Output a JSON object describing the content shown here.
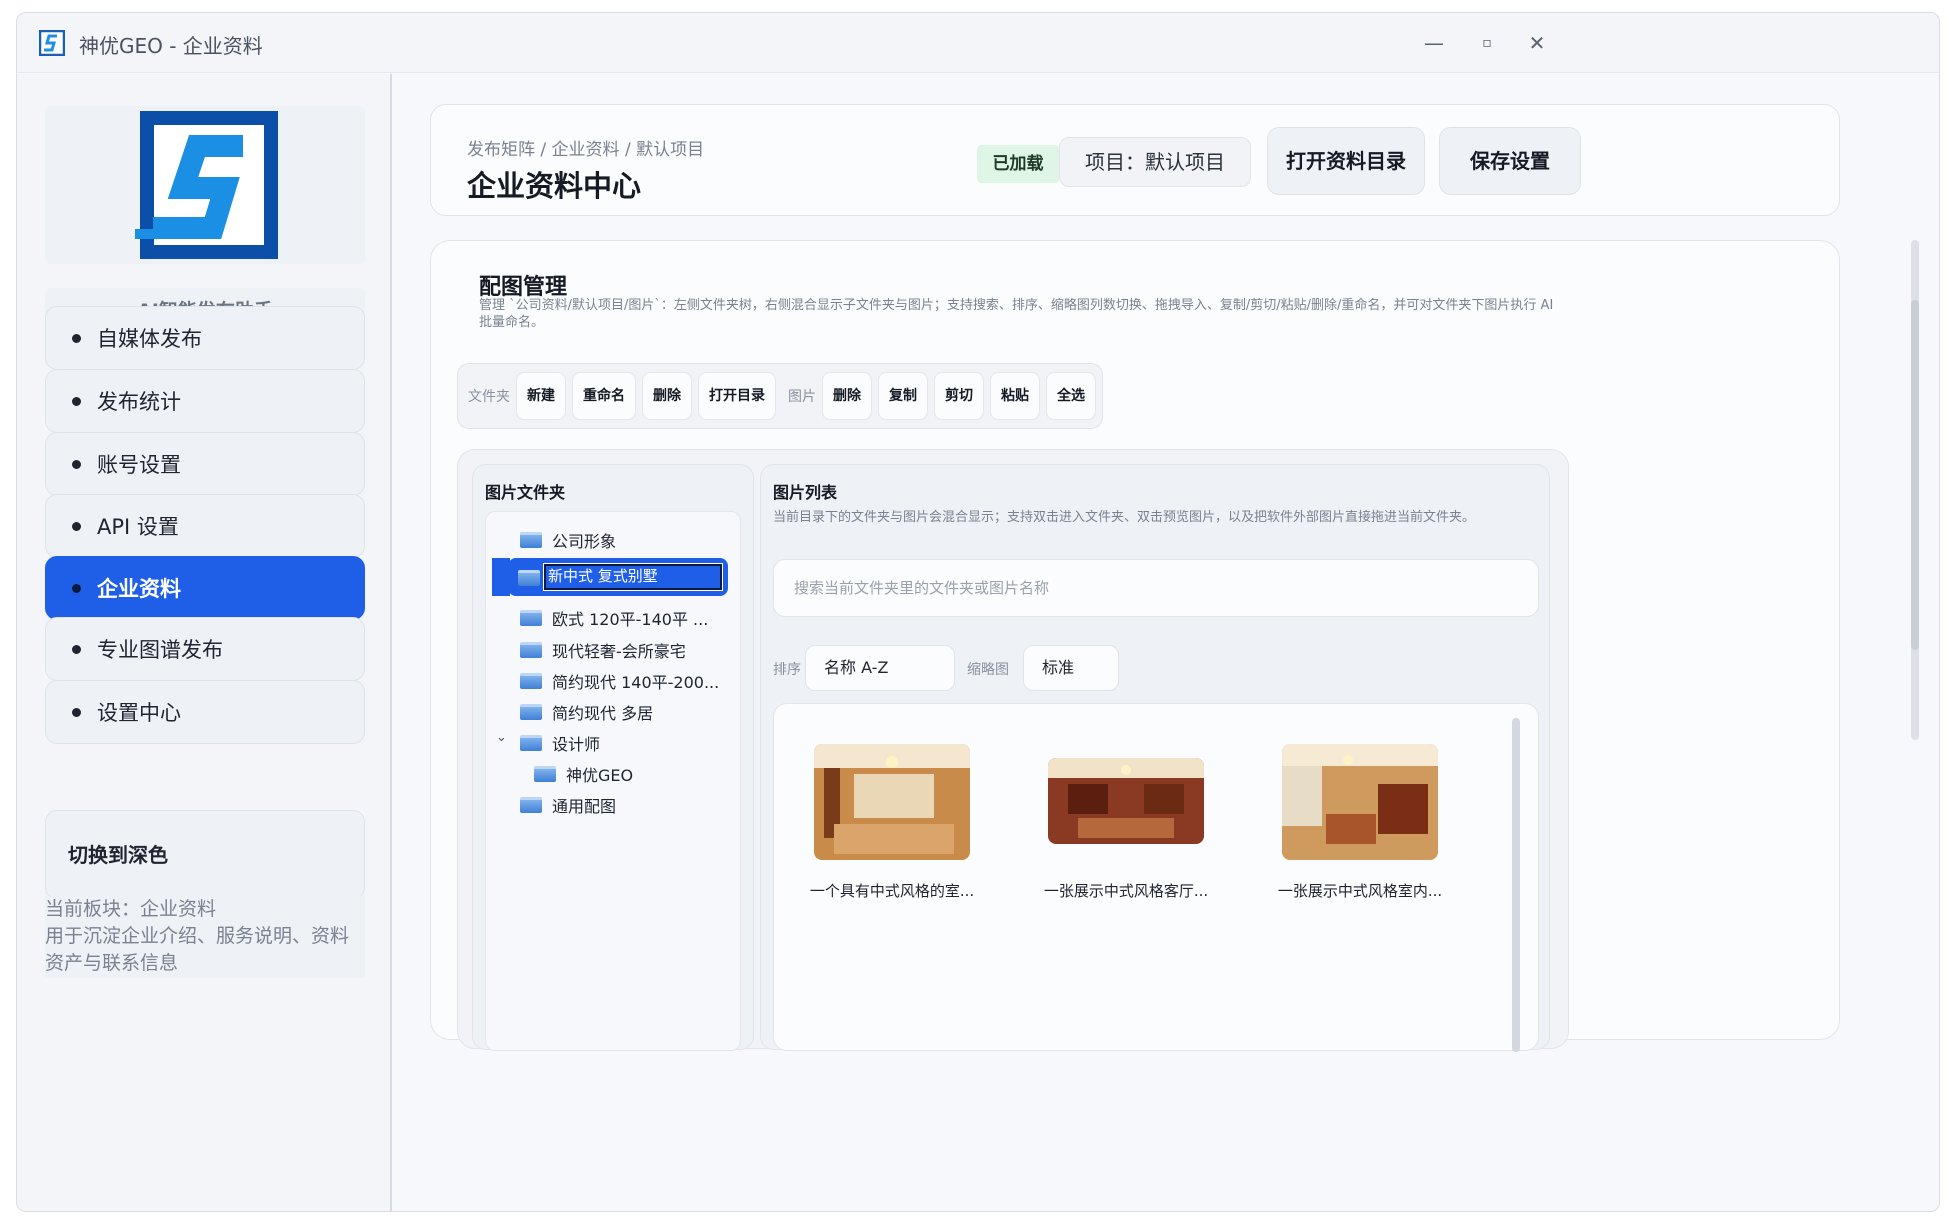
{
  "window": {
    "title": "神优GEO - 企业资料",
    "controls": {
      "minimize": "—",
      "maximize": "▫",
      "close": "✕"
    }
  },
  "sidebar": {
    "brand_subtitle": "AI智能发布助手",
    "items": [
      {
        "label": "自媒体发布"
      },
      {
        "label": "发布统计"
      },
      {
        "label": "账号设置"
      },
      {
        "label": "API 设置"
      },
      {
        "label": "企业资料",
        "active": true
      },
      {
        "label": "专业图谱发布"
      },
      {
        "label": "设置中心"
      }
    ],
    "theme_toggle": "切换到深色",
    "module_info": {
      "line1": "当前板块：企业资料",
      "line2": "用于沉淀企业介绍、服务说明、资料资产与联系信息"
    }
  },
  "header": {
    "breadcrumb": "发布矩阵 / 企业资料 / 默认项目",
    "title": "企业资料中心",
    "status_badge": "已加载",
    "project": "项目：默认项目",
    "open_dir_button": "打开资料目录",
    "save_button": "保存设置"
  },
  "section": {
    "title": "配图管理",
    "description": "管理 `公司资料/默认项目/图片`：左侧文件夹树，右侧混合显示子文件夹与图片；支持搜索、排序、缩略图列数切换、拖拽导入、复制/剪切/粘贴/删除/重命名，并可对文件夹下图片执行 AI 批量命名。"
  },
  "toolbar": {
    "folder_label": "文件夹",
    "folder_new": "新建",
    "folder_rename": "重命名",
    "folder_delete": "删除",
    "folder_open": "打开目录",
    "image_label": "图片",
    "image_delete": "删除",
    "image_copy": "复制",
    "image_cut": "剪切",
    "image_paste": "粘贴",
    "image_select_all": "全选"
  },
  "folder_panel": {
    "title": "图片文件夹",
    "items": [
      {
        "label": "公司形象"
      },
      {
        "label": "新中式 复式别墅",
        "selected": true,
        "editing": true
      },
      {
        "label": "欧式 120平-140平 ..."
      },
      {
        "label": "现代轻奢-会所豪宅"
      },
      {
        "label": "简约现代 140平-200..."
      },
      {
        "label": "简约现代 多居"
      },
      {
        "label": "设计师",
        "expanded": true
      },
      {
        "label": "神优GEO",
        "child": true
      },
      {
        "label": "通用配图"
      }
    ],
    "expand_icon": "⌄"
  },
  "image_panel": {
    "title": "图片列表",
    "description": "当前目录下的文件夹与图片会混合显示；支持双击进入文件夹、双击预览图片，以及把软件外部图片直接拖进当前文件夹。",
    "search_placeholder": "搜索当前文件夹里的文件夹或图片名称",
    "sort_label": "排序",
    "sort_value": "名称 A-Z",
    "thumb_label": "缩略图",
    "thumb_value": "标准",
    "images": [
      {
        "caption": "一个具有中式风格的室..."
      },
      {
        "caption": "一张展示中式风格客厅..."
      },
      {
        "caption": "一张展示中式风格室内..."
      }
    ]
  },
  "colors": {
    "accent": "#1f5fe8",
    "badge_bg": "#dff5e6",
    "panel_bg": "#eef1f5"
  }
}
